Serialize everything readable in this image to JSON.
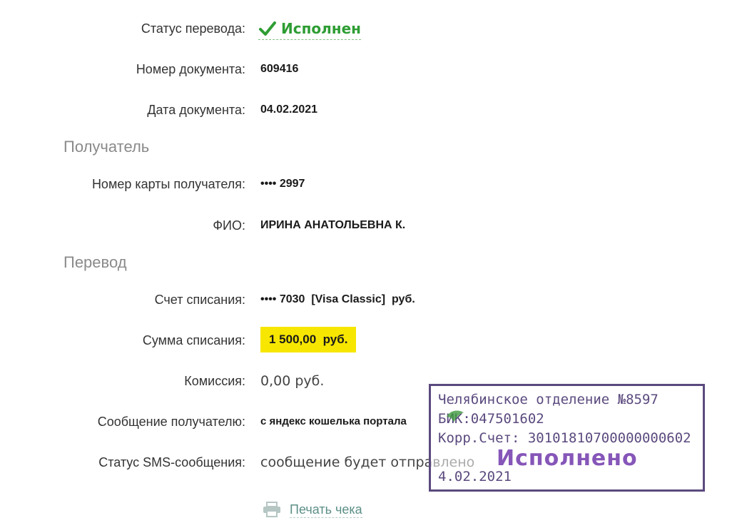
{
  "transfer": {
    "status_label": "Статус перевода:",
    "status_value": "Исполнен",
    "doc_number_label": "Номер документа:",
    "doc_number_value": "609416",
    "doc_date_label": "Дата документа:",
    "doc_date_value": "04.02.2021"
  },
  "recipient": {
    "section_title": "Получатель",
    "card_label": "Номер карты получателя:",
    "card_value": "•••• 2997",
    "name_label": "ФИО:",
    "name_value": "ИРИНА АНАТОЛЬЕВНА К."
  },
  "payment": {
    "section_title": "Перевод",
    "account_label": "Счет списания:",
    "account_value": "•••• 7030  [Visa Classic]  руб.",
    "amount_label": "Сумма списания:",
    "amount_value": "1 500,00  руб.",
    "fee_label": "Комиссия:",
    "fee_value": "0,00 руб.",
    "message_label": "Сообщение получателю:",
    "message_value": "с яндекс кошелька портала",
    "sms_label": "Статус SMS-сообщения:",
    "sms_value": "сообщение будет отправлено"
  },
  "print": {
    "label": "Печать чека"
  },
  "stamp": {
    "branch": "Челябинское отделение №8597",
    "bik": "БИК:047501602",
    "corr": "Корр.Счет: 30101810700000000602",
    "status": "Исполнено",
    "date": "4.02.2021"
  },
  "colors": {
    "status_green": "#2e9d34",
    "amount_highlight": "#f7e600",
    "stamp_purple": "#5b4a7e",
    "link_teal": "#5c8f86"
  }
}
